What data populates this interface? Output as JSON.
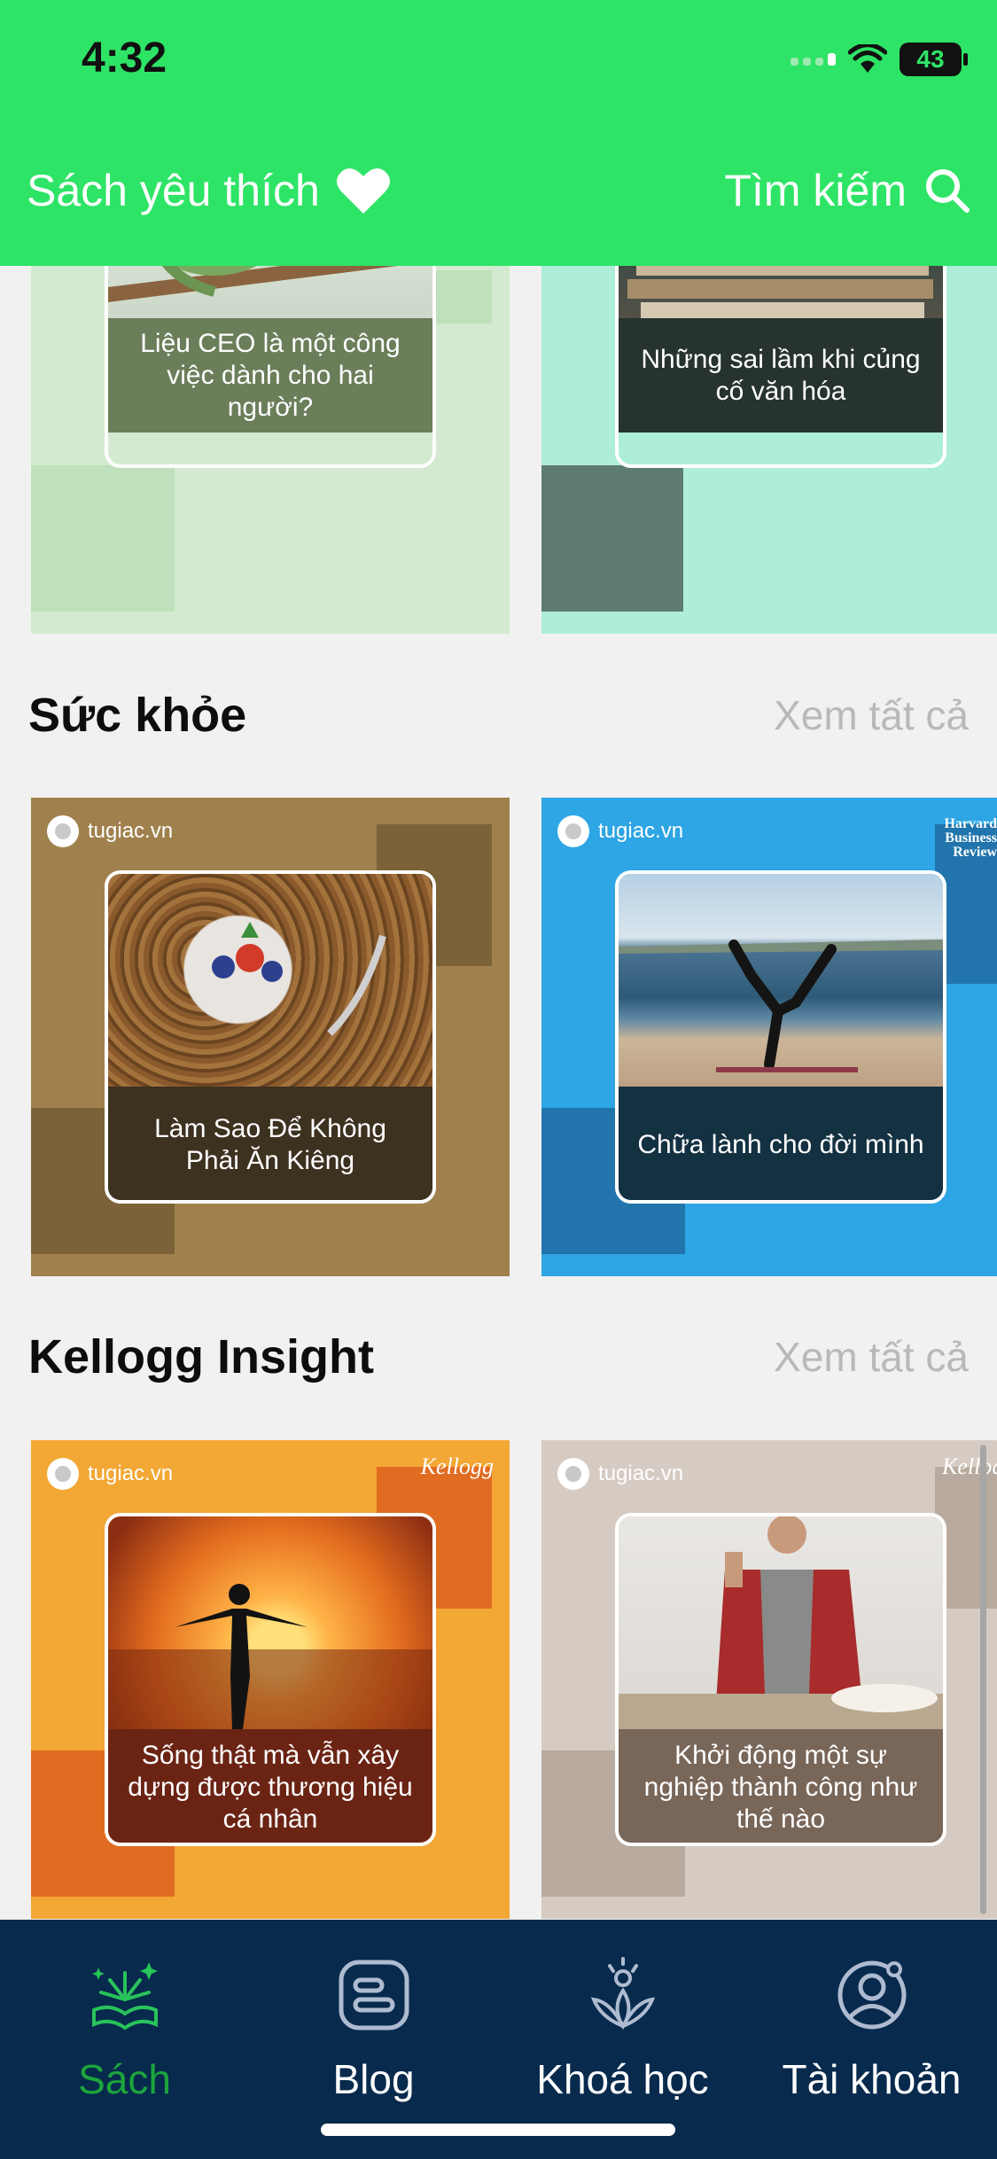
{
  "status_bar": {
    "time": "4:32",
    "battery": "43"
  },
  "header": {
    "title": "Sách yêu thích",
    "search_label": "Tìm kiếm"
  },
  "sections": [
    {
      "cards": [
        {
          "caption": "Liệu CEO là một công việc dành cho hai người?"
        },
        {
          "caption": "Những sai lầm khi củng cố văn hóa"
        }
      ]
    },
    {
      "title": "Sức khỏe",
      "see_all": "Xem tất cả",
      "cards": [
        {
          "brand": "tugiac.vn",
          "caption": "Làm Sao Để Không Phải Ăn Kiêng"
        },
        {
          "brand": "tugiac.vn",
          "corner": "Harvard Business Review",
          "caption": "Chữa lành cho đời mình"
        }
      ]
    },
    {
      "title": "Kellogg Insight",
      "see_all": "Xem tất cả",
      "cards": [
        {
          "brand": "tugiac.vn",
          "corner": "Kellogg",
          "caption": "Sống thật mà vẫn xây dựng được thương hiệu cá nhân"
        },
        {
          "brand": "tugiac.vn",
          "corner": "Kellogg",
          "caption": "Khởi động một sự nghiệp thành công như thế nào"
        }
      ]
    }
  ],
  "bottom_nav": [
    {
      "label": "Sách",
      "icon": "book-sparkle-icon",
      "active": true
    },
    {
      "label": "Blog",
      "icon": "blog-icon",
      "active": false
    },
    {
      "label": "Khoá học",
      "icon": "lotus-icon",
      "active": false
    },
    {
      "label": "Tài khoản",
      "icon": "account-icon",
      "active": false
    }
  ],
  "colors": {
    "header": "#2ee466",
    "nav_bg": "#082a4d",
    "nav_active": "#1ca53c"
  }
}
